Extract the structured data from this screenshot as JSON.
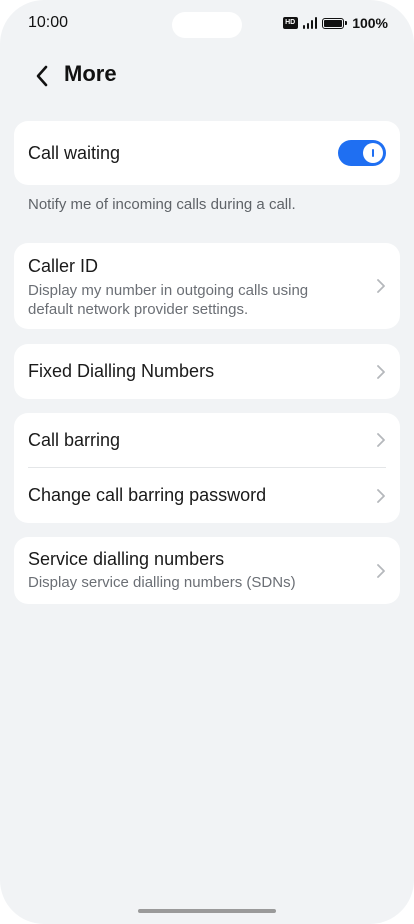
{
  "status_bar": {
    "time": "10:00",
    "hd": "HD",
    "battery": "100%"
  },
  "header": {
    "title": "More"
  },
  "call_waiting": {
    "label": "Call waiting",
    "enabled": true,
    "description": "Notify me of incoming calls during a call."
  },
  "caller_id": {
    "title": "Caller ID",
    "subtitle": "Display my number in outgoing calls using default network provider settings."
  },
  "fixed_dialling": {
    "title": "Fixed Dialling Numbers"
  },
  "barring": {
    "call_barring": "Call barring",
    "change_password": "Change call barring password"
  },
  "service_dialling": {
    "title": "Service dialling numbers",
    "subtitle": "Display service dialling numbers (SDNs)"
  },
  "colors": {
    "accent": "#1f6ff2",
    "background": "#f1f3f5",
    "card": "#ffffff"
  },
  "icons": {
    "back": "chevron-left-icon",
    "row_arrow": "chevron-right-icon"
  }
}
